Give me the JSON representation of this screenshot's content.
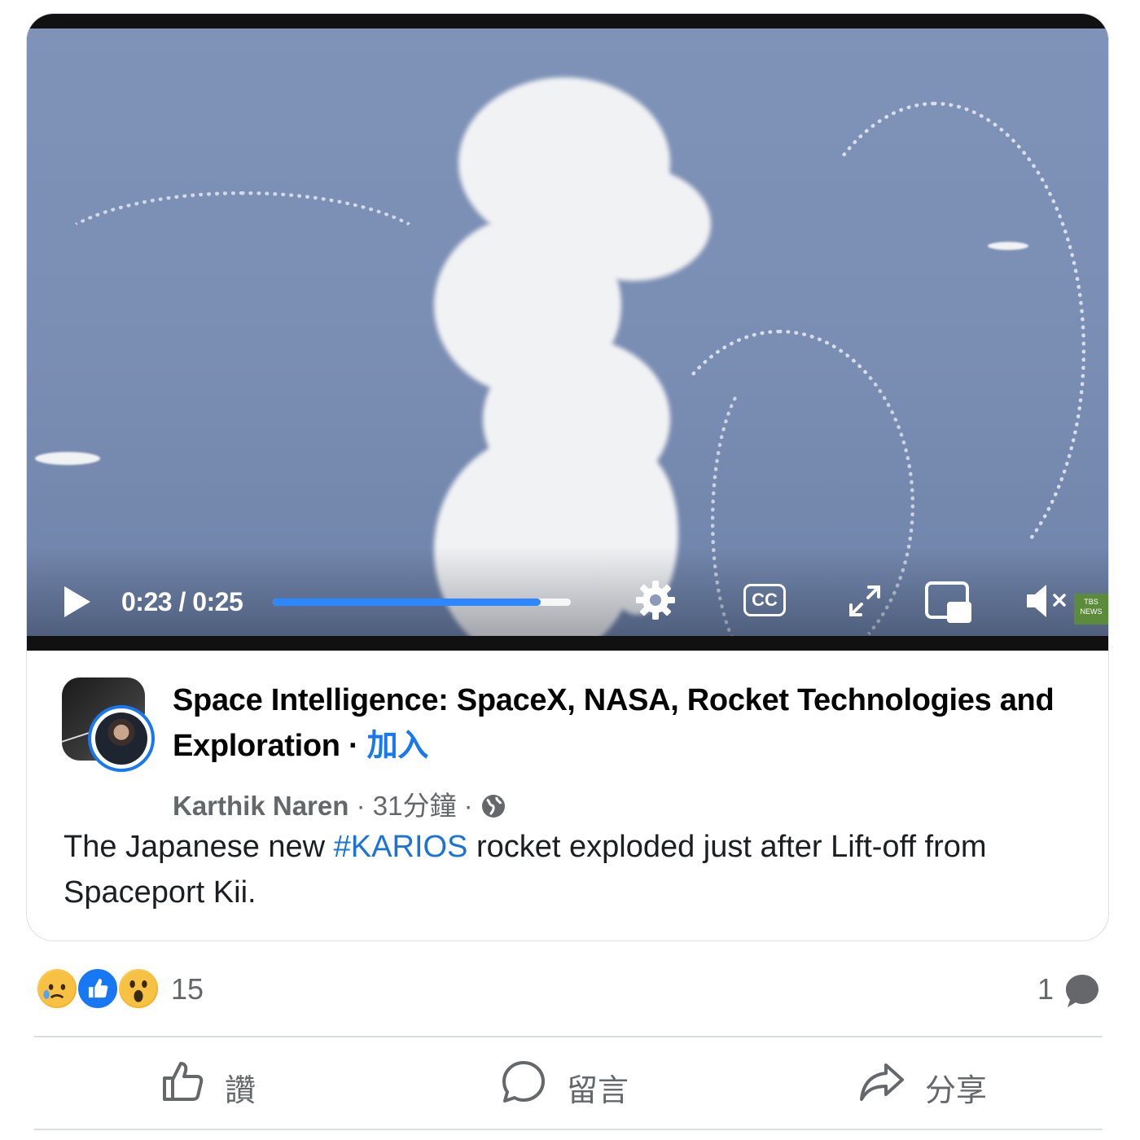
{
  "video": {
    "current_time": "0:23",
    "duration": "0:25",
    "time_display": "0:23 / 0:25",
    "progress_fraction": 0.9,
    "cc_label": "CC",
    "watermark_text": "TBS NEWS",
    "icons": [
      "play-icon",
      "settings-icon",
      "cc-icon",
      "expand-icon",
      "pip-icon",
      "muted-speaker-icon"
    ]
  },
  "post": {
    "page_name": "Space Intelligence: SpaceX, NASA, Rocket Technologies and Exploration",
    "separator": " · ",
    "join_label": "加入",
    "author": "Karthik Naren",
    "time_ago": "31分鐘",
    "dot": " · ",
    "privacy_icon": "globe-icon",
    "text_before": "The Japanese new ",
    "hashtag": "#KARIOS",
    "text_after": " rocket exploded just after Lift-off from Spaceport Kii."
  },
  "engagement": {
    "reaction_icons": [
      "sad-reaction-icon",
      "like-reaction-icon",
      "wow-reaction-icon"
    ],
    "reaction_count": "15",
    "comment_count": "1"
  },
  "actions": {
    "like_label": "讚",
    "comment_label": "留言",
    "share_label": "分享"
  },
  "colors": {
    "accent": "#1877f2",
    "secondary_text": "#65676b",
    "sky": "#7f93b8"
  }
}
